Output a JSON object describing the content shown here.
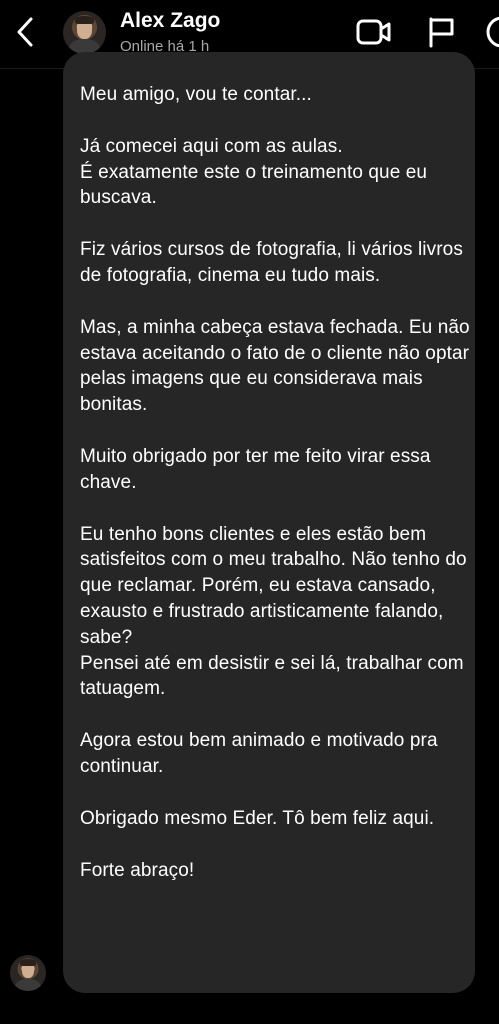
{
  "header": {
    "contact_name": "Alex Zago",
    "contact_status": "Online há 1 h",
    "icons": {
      "back": "chevron-left-icon",
      "video": "video-camera-icon",
      "flag": "flag-icon",
      "info": "info-icon"
    }
  },
  "message": {
    "paragraphs": [
      "Meu amigo, vou te contar...",
      "Já comecei aqui com as aulas.\nÉ exatamente este o treinamento que eu buscava.",
      "Fiz vários cursos de fotografia, li vários livros de fotografia, cinema eu tudo mais.",
      "Mas, a minha cabeça estava fechada. Eu não estava aceitando o fato de o cliente não optar pelas imagens que eu considerava mais bonitas.",
      "Muito obrigado por ter me feito virar essa chave.",
      "Eu tenho bons clientes e eles estão bem satisfeitos com o meu trabalho. Não tenho do que reclamar. Porém, eu estava cansado, exausto e frustrado artisticamente falando, sabe?\nPensei até em desistir e sei lá, trabalhar com tatuagem.",
      "Agora estou bem animado e motivado pra continuar.",
      "Obrigado mesmo Eder. Tô bem feliz aqui.",
      "Forte abraço!"
    ]
  },
  "colors": {
    "background": "#000000",
    "bubble": "#262626",
    "text": "#ffffff",
    "secondary_text": "#a8a8a8"
  }
}
